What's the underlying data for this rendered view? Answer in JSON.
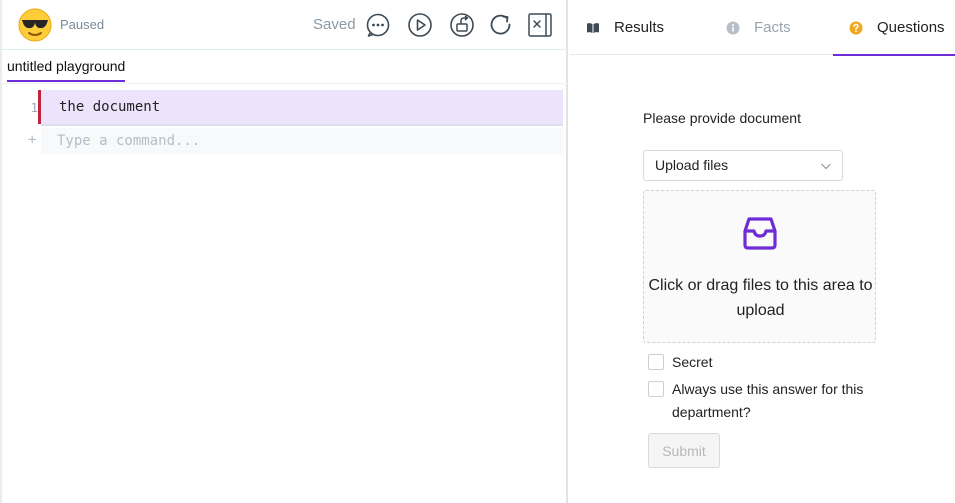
{
  "app": {
    "status": "Paused",
    "saved_label": "Saved",
    "avatar": "sunglasses-emoji",
    "toolbar_icons": [
      "comment-dots-icon",
      "play-icon",
      "share-icon",
      "refresh-icon",
      "close-panel-icon"
    ]
  },
  "document": {
    "tab_title": "untitled playground",
    "lines": [
      {
        "number": "1",
        "text": "the document"
      }
    ],
    "new_line_marker": "+",
    "command_placeholder": "Type a command..."
  },
  "right_panel": {
    "tabs": [
      {
        "label": "Results",
        "icon": "book-open-icon",
        "state": "normal"
      },
      {
        "label": "Facts",
        "icon": "info-icon",
        "state": "muted"
      },
      {
        "label": "Questions",
        "icon": "question-icon",
        "state": "active"
      }
    ],
    "question": {
      "prompt": "Please provide document",
      "select_value": "Upload files",
      "dropzone_text": "Click or drag files to this area to upload",
      "checkboxes": [
        {
          "label": "Secret",
          "checked": false
        },
        {
          "label": "Always use this answer for this department?",
          "checked": false
        }
      ],
      "submit_label": "Submit"
    }
  },
  "colors": {
    "accent": "#6d2cd6",
    "line_marker": "#c1243c",
    "active_line_bg": "#ede4fb",
    "question_badge": "#f0a81e"
  }
}
